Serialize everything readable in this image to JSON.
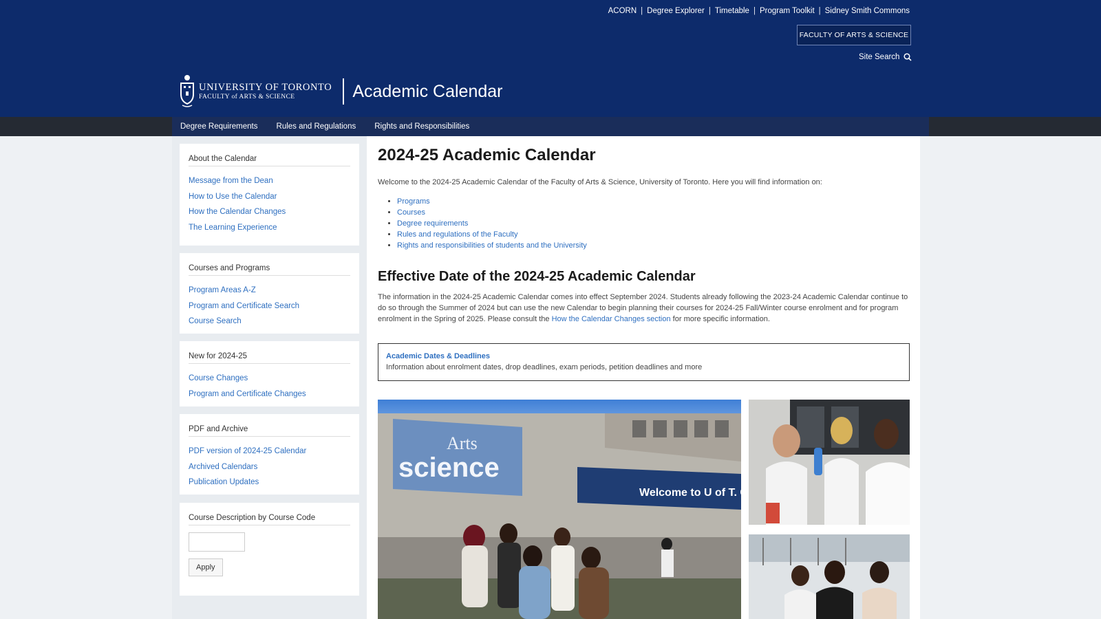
{
  "header": {
    "util_links": [
      "ACORN",
      "Degree Explorer",
      "Timetable",
      "Program Toolkit",
      "Sidney Smith Commons"
    ],
    "separator": "|",
    "faculty_button": "FACULTY OF ARTS & SCIENCE",
    "site_search": "Site Search",
    "brand_line1": "UNIVERSITY OF TORONTO",
    "brand_line2": "FACULTY of ARTS & SCIENCE",
    "calendar_title": "Academic Calendar",
    "bg_color": "#0d2b6b"
  },
  "nav": {
    "items": [
      "Degree Requirements",
      "Rules and Regulations",
      "Rights and Responsibilities"
    ]
  },
  "sidebar": {
    "sections": [
      {
        "heading": "About the Calendar",
        "links": [
          "Message from the Dean",
          "How to Use the Calendar",
          "How the Calendar Changes",
          "The Learning Experience"
        ]
      },
      {
        "heading": "Courses and Programs",
        "links": [
          "Program Areas A-Z",
          "Program and Certificate Search",
          "Course Search"
        ]
      },
      {
        "heading": "New for 2024-25",
        "links": [
          "Course Changes",
          "Program and Certificate Changes"
        ]
      },
      {
        "heading": "PDF and Archive",
        "links": [
          "PDF version of 2024-25 Calendar",
          "Archived Calendars",
          "Publication Updates"
        ]
      }
    ],
    "course_code": {
      "heading": "Course Description by Course Code",
      "input_value": "",
      "apply_label": "Apply"
    }
  },
  "main": {
    "title": "2024-25 Academic Calendar",
    "intro": "Welcome to the 2024-25 Academic Calendar of the Faculty of Arts & Science, University of Toronto. Here you will find information on:",
    "intro_links": [
      "Programs",
      "Courses",
      "Degree requirements",
      "Rules and regulations of the Faculty",
      "Rights and responsibilities of students and the University"
    ],
    "effective_heading": "Effective Date of the 2024-25 Academic Calendar",
    "effective_text_1": "The information in the 2024-25 Academic Calendar comes into effect September 2024. Students already following the 2023-24 Academic Calendar continue to do so through the Summer of 2024 but can use the new Calendar to begin planning their courses for 2024-25 Fall/Winter course enrolment and for program enrolment in the Spring of 2025. Please consult the",
    "effective_link": "How the Calendar Changes section",
    "effective_text_2": "for more specific information.",
    "deadlines_title": "Academic Dates & Deadlines",
    "deadlines_desc": "Information about enrolment dates, drop deadlines, exam periods, petition deadlines and more",
    "photo_banner_1": "Arts",
    "photo_banner_2": "science",
    "photo_welcome": "Welcome to U of T. Come an"
  }
}
